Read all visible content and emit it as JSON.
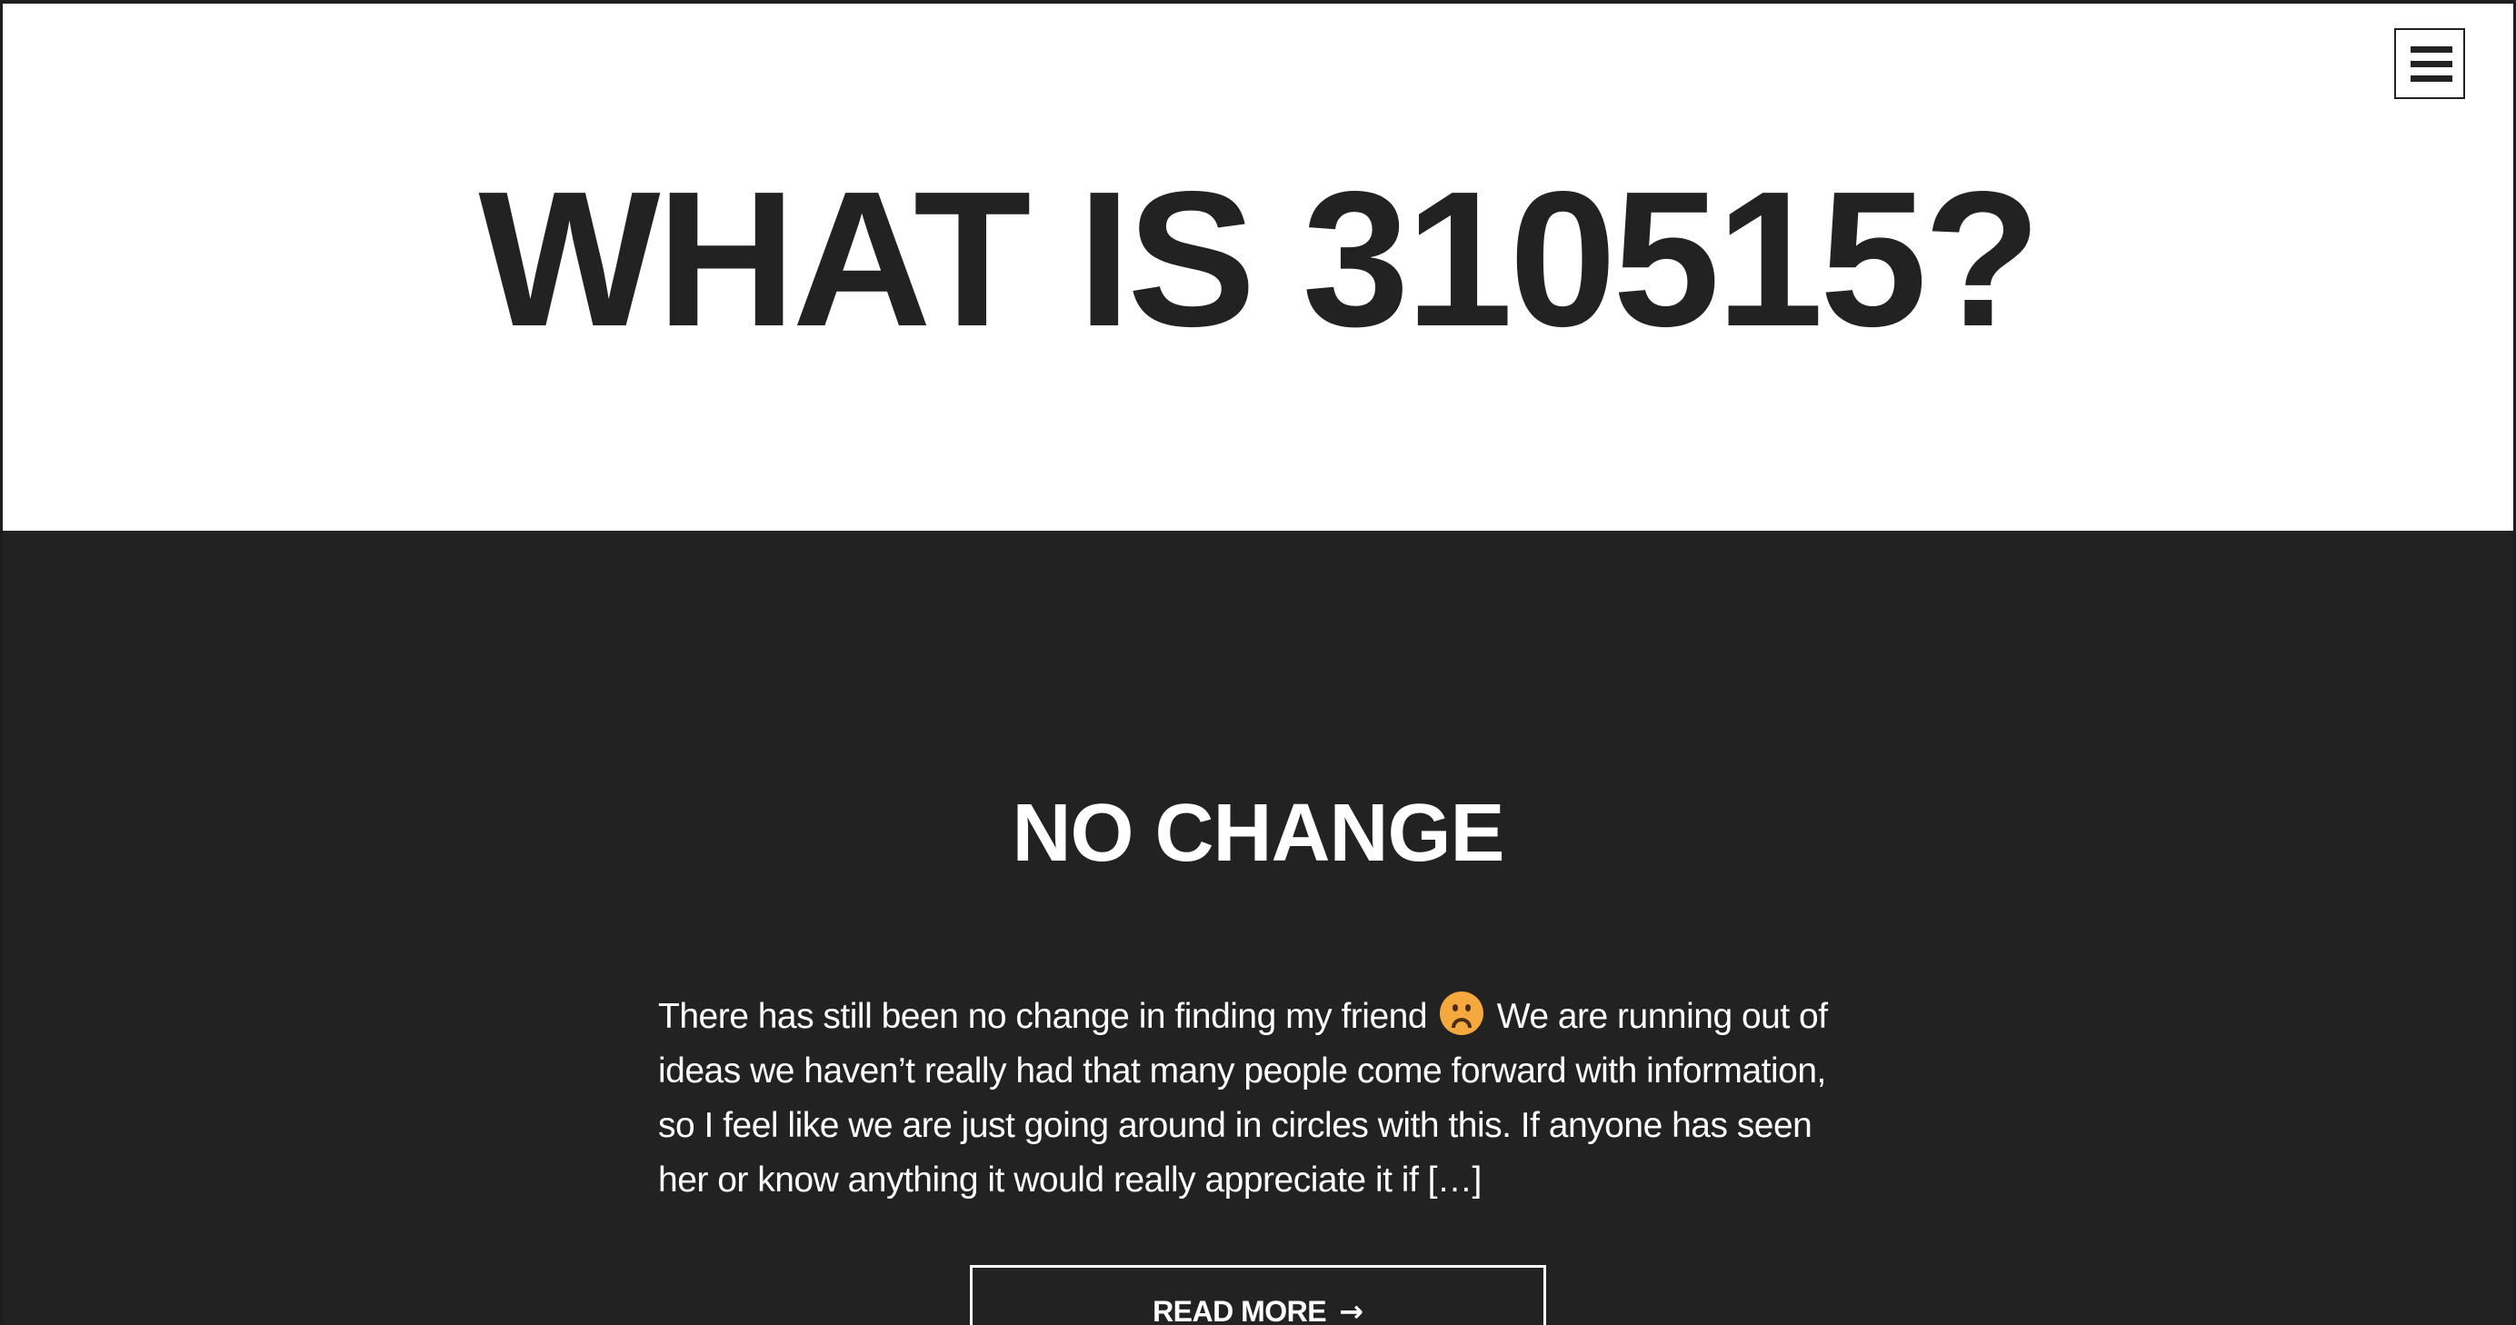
{
  "header": {
    "site_title": "WHAT IS 310515?",
    "menu_icon": "hamburger-menu-icon"
  },
  "post": {
    "title": "NO CHANGE",
    "excerpt_part1": "There has still been no change in finding my friend",
    "excerpt_emoji": "frowning-face-icon",
    "excerpt_part2": "We are running out of ideas we haven’t really had that many people come forward with information, so I feel like we are just going around in circles with this. If anyone has seen her or know anything it would really appreciate it if […]",
    "read_more_label": "READ MORE",
    "read_more_icon": "right-arrow-icon"
  },
  "colors": {
    "header_bg": "#ffffff",
    "title_text": "#222222",
    "content_bg": "#222222",
    "content_text": "#ffffff",
    "emoji": "#f4a83d"
  }
}
